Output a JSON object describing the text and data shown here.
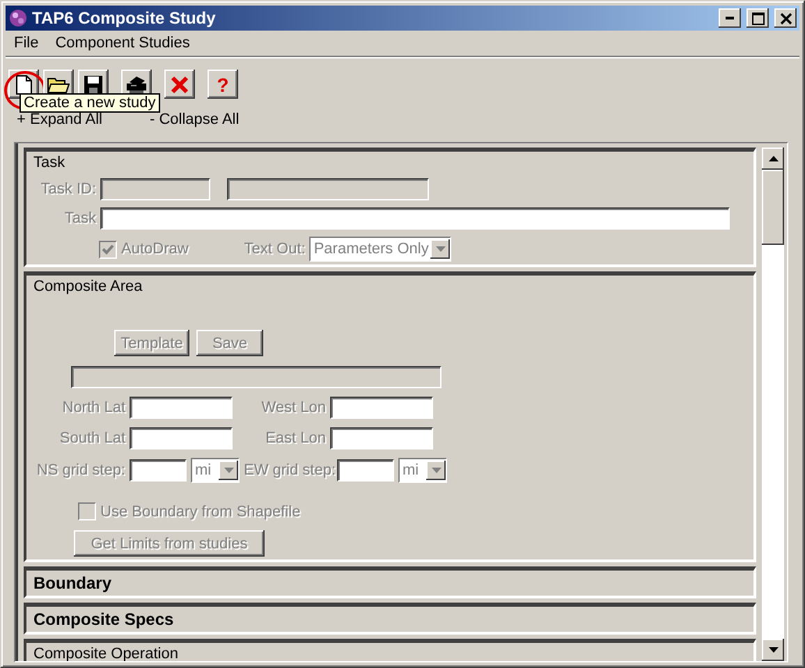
{
  "window": {
    "title": "TAP6 Composite Study"
  },
  "menu": [
    "File",
    "Component Studies"
  ],
  "toolbar": [
    {
      "kind": "new",
      "circled": true
    },
    {
      "kind": "open",
      "circled": false
    },
    {
      "kind": "save",
      "circled": false
    },
    {
      "kind": "print",
      "circled": false
    },
    {
      "kind": "delete",
      "circled": false
    },
    {
      "kind": "help",
      "glyph": "?",
      "circled": false
    }
  ],
  "tooltip": "Create a new study",
  "expand_all": "+ Expand All",
  "collapse_all": "- Collapse All",
  "sections": [
    {
      "kind": "task",
      "title": "Task",
      "expanded": true,
      "task_id_label": "Task ID:",
      "task_label": "Task",
      "autodraw": {
        "label": "AutoDraw",
        "checked": true,
        "disabled": true
      },
      "text_out_label": "Text Out:",
      "text_out_value": "Parameters Only"
    },
    {
      "kind": "area",
      "title": "Composite Area",
      "expanded": true,
      "buttons": [
        {
          "label": "Template",
          "disabled": true
        },
        {
          "label": "Save",
          "disabled": true
        }
      ],
      "north_lat": "North Lat",
      "west_lon": "West Lon",
      "south_lat": "South Lat",
      "east_lon": "East Lon",
      "ns_step": "NS grid step:",
      "ns_unit": "mi",
      "ew_step": "EW grid step:",
      "ew_unit": "mi",
      "shapefile": {
        "label": "Use Boundary from Shapefile",
        "checked": false,
        "disabled": true
      },
      "limits_button": {
        "label": "Get Limits from studies",
        "disabled": true
      }
    },
    {
      "kind": "header",
      "title": "Boundary",
      "expanded": false
    },
    {
      "kind": "header",
      "title": "Composite Specs",
      "expanded": false
    },
    {
      "kind": "header",
      "title": "Composite Operation",
      "expanded": true
    }
  ]
}
